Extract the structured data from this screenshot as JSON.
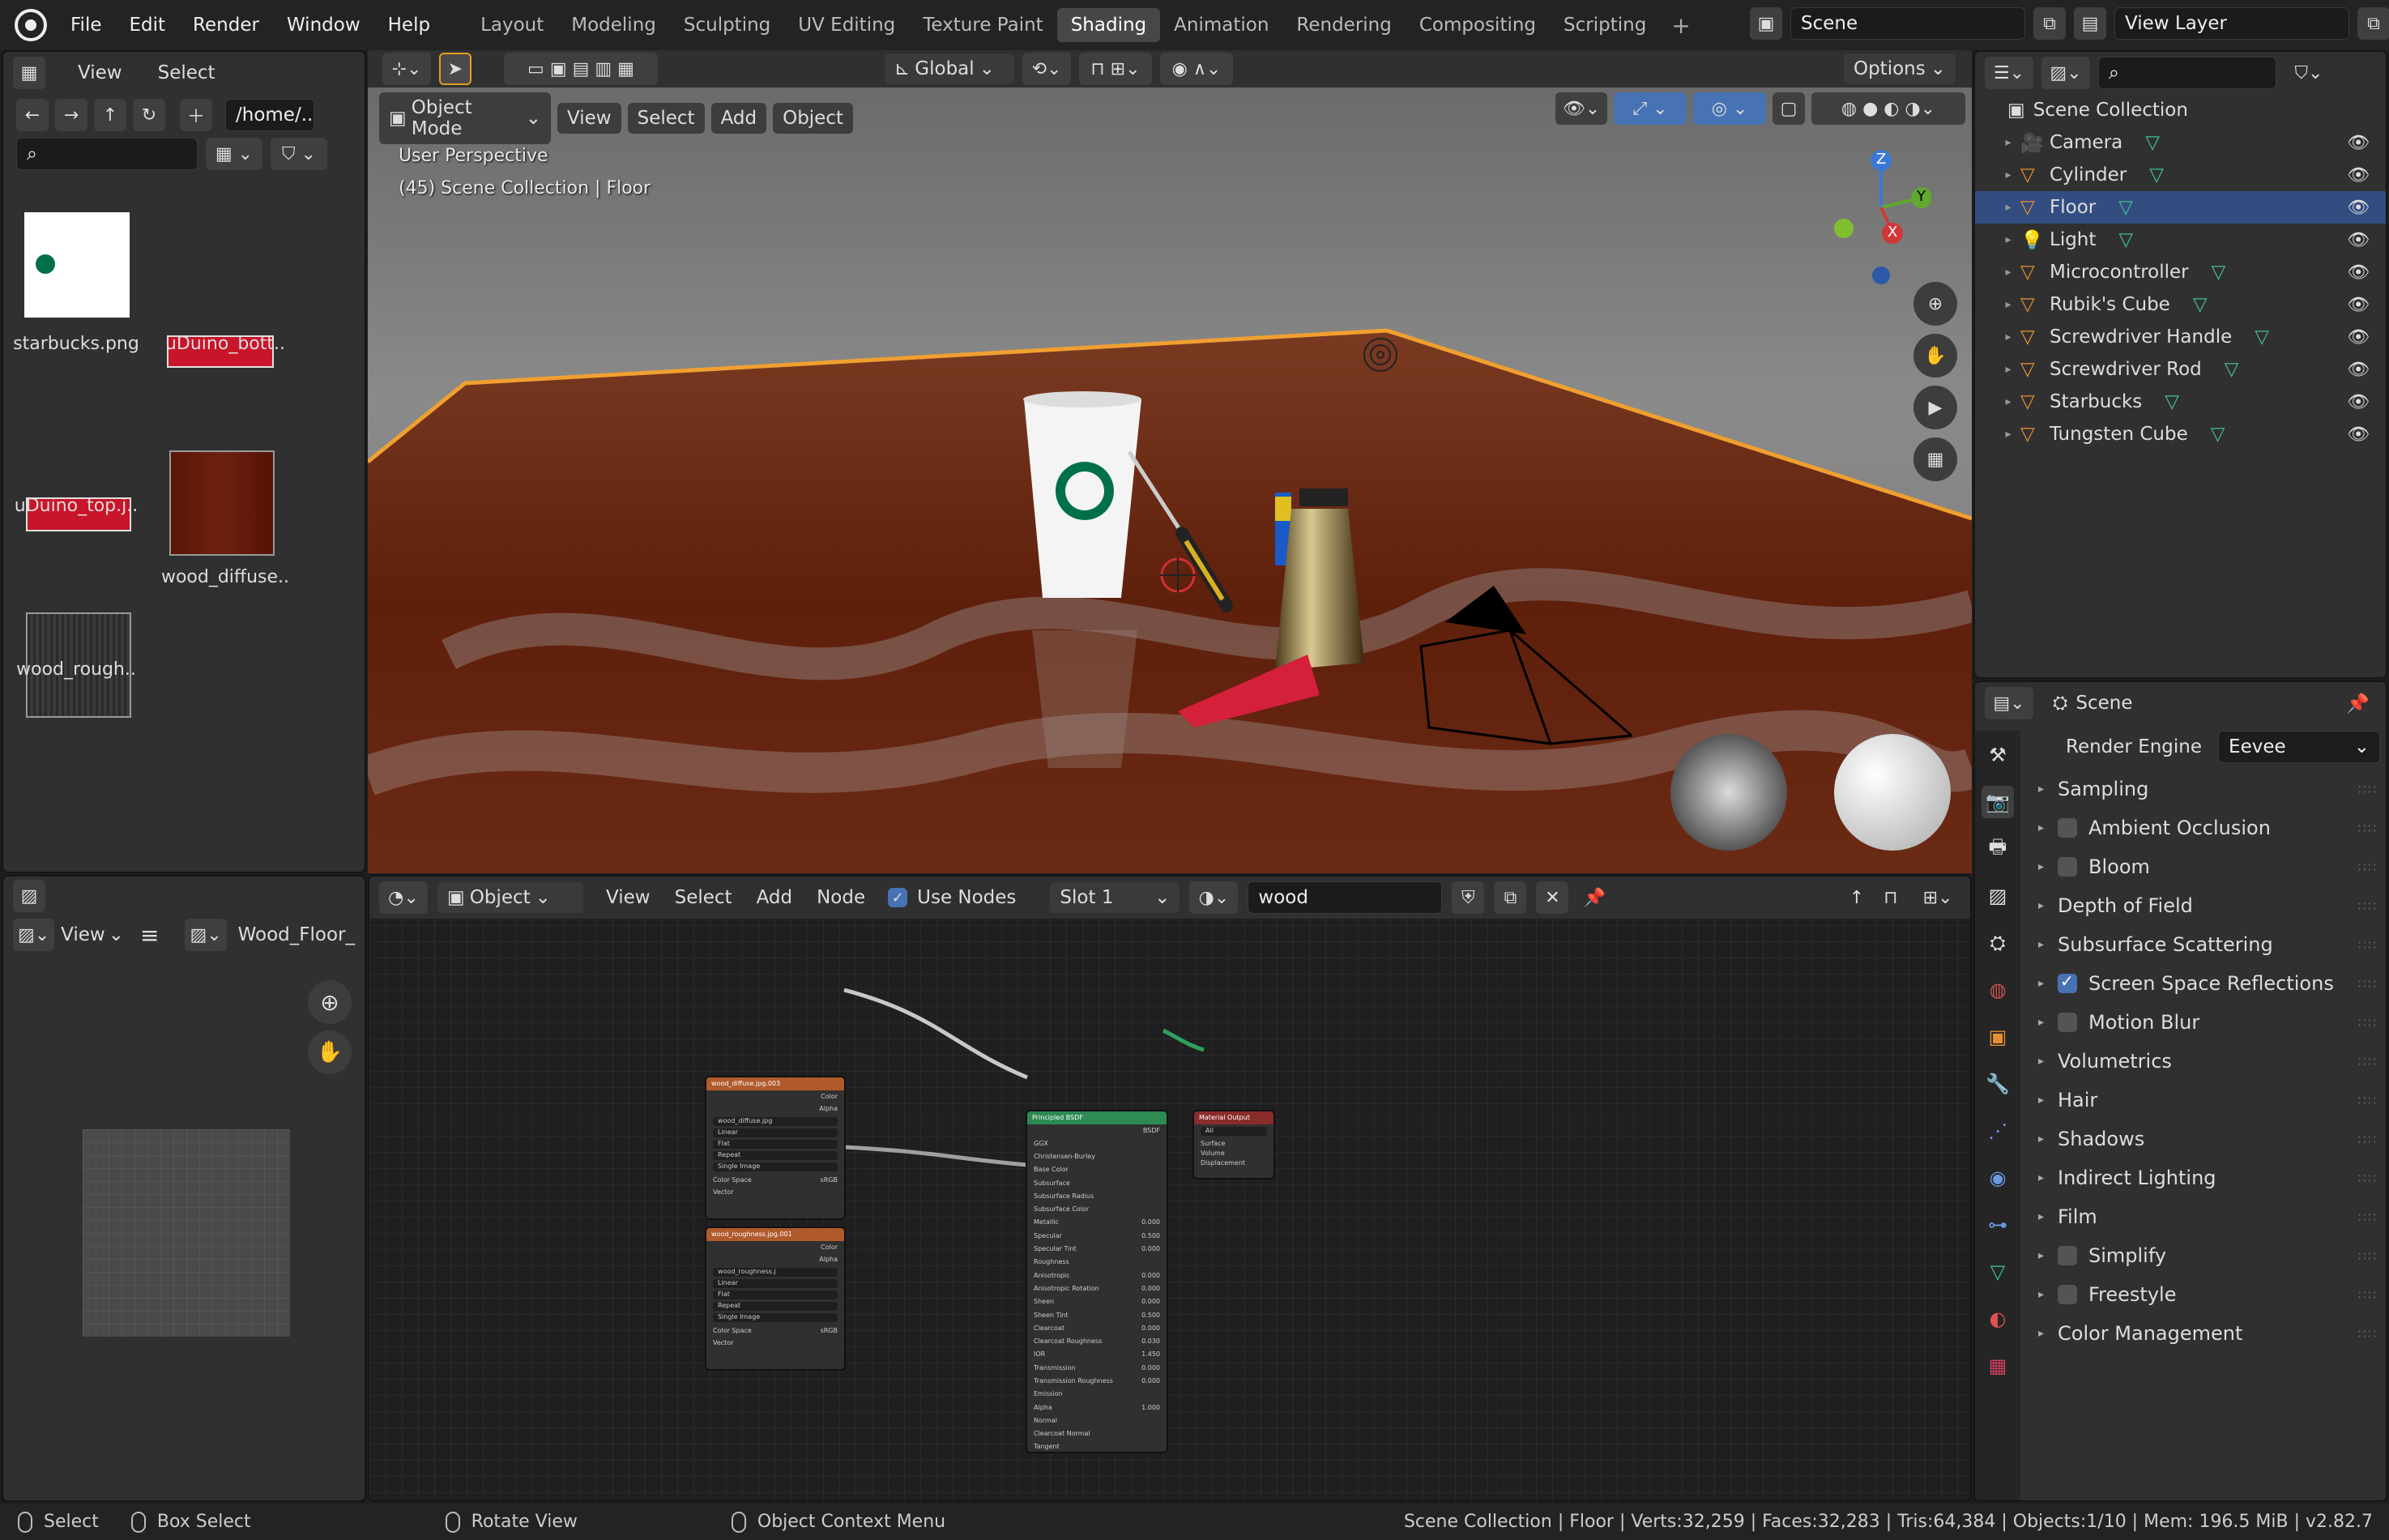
{
  "menubar": {
    "items": [
      "File",
      "Edit",
      "Render",
      "Window",
      "Help"
    ],
    "workspaces": [
      "Layout",
      "Modeling",
      "Sculpting",
      "UV Editing",
      "Texture Paint",
      "Shading",
      "Animation",
      "Rendering",
      "Compositing",
      "Scripting"
    ],
    "active_workspace": "Shading",
    "scene_name": "Scene",
    "view_layer": "View Layer"
  },
  "file_browser": {
    "menu": [
      "View",
      "Select"
    ],
    "path": "/home/..",
    "files": [
      "starbucks.png",
      "uDuino_bott..",
      "uDuino_top.j..",
      "wood_diffuse..",
      "wood_rough.."
    ]
  },
  "viewport": {
    "toolbar": {
      "orientation": "Global",
      "options": "Options"
    },
    "mode": "Object Mode",
    "menu": [
      "View",
      "Select",
      "Add",
      "Object"
    ],
    "perspective": "User Perspective",
    "collection_info": "(45) Scene Collection | Floor",
    "gizmo_axes": [
      "Z",
      "Y",
      "X"
    ]
  },
  "image_editor": {
    "view": "View",
    "image_name": "Wood_Floor_",
    "label": "wood"
  },
  "node_editor": {
    "type": "Object",
    "menu": [
      "View",
      "Select",
      "Add",
      "Node"
    ],
    "use_nodes_label": "Use Nodes",
    "slot": "Slot 1",
    "material": "wood",
    "nodes": {
      "diffuse": {
        "title": "wood_diffuse.jpg.003",
        "rows": [
          "Color",
          "Alpha"
        ],
        "fields": [
          "wood_diffuse.jpg",
          "Linear",
          "Flat",
          "Repeat",
          "Single Image",
          "Color Space",
          "Vector"
        ],
        "color_space": "sRGB"
      },
      "rough": {
        "title": "wood_roughness.jpg.001",
        "rows": [
          "Color",
          "Alpha"
        ],
        "fields": [
          "wood_roughness.j",
          "Linear",
          "Flat",
          "Repeat",
          "Single Image",
          "Color Space",
          "Vector"
        ],
        "color_space": "sRGB"
      },
      "bsdf": {
        "title": "Principled BSDF",
        "out": "BSDF",
        "fields": [
          "GGX",
          "Christensen-Burley",
          "Base Color",
          "Subsurface",
          "Subsurface Radius",
          "Subsurface Color",
          "Metallic",
          "Specular",
          "Specular Tint",
          "Roughness",
          "Anisotropic",
          "Anisotropic Rotation",
          "Sheen",
          "Sheen Tint",
          "Clearcoat",
          "Clearcoat Roughness",
          "IOR",
          "Transmission",
          "Transmission Roughness",
          "Emission",
          "Alpha",
          "Normal",
          "Clearcoat Normal",
          "Tangent"
        ],
        "values": [
          "",
          "",
          "",
          "",
          "",
          "",
          "0.000",
          "0.500",
          "0.000",
          "",
          "0.000",
          "0.000",
          "0.000",
          "0.500",
          "0.000",
          "0.030",
          "1.450",
          "0.000",
          "0.000",
          "",
          "1.000",
          "",
          "",
          ""
        ]
      },
      "output": {
        "title": "Material Output",
        "fields": [
          "All",
          "Surface",
          "Volume",
          "Displacement"
        ]
      }
    }
  },
  "outliner": {
    "root": "Scene Collection",
    "items": [
      {
        "label": "Camera",
        "icon": "camera-icon",
        "selected": false
      },
      {
        "label": "Cylinder",
        "icon": "mesh-icon",
        "selected": false
      },
      {
        "label": "Floor",
        "icon": "mesh-icon",
        "selected": true
      },
      {
        "label": "Light",
        "icon": "light-icon",
        "selected": false
      },
      {
        "label": "Microcontroller",
        "icon": "mesh-icon",
        "selected": false
      },
      {
        "label": "Rubik's Cube",
        "icon": "mesh-icon",
        "selected": false
      },
      {
        "label": "Screwdriver Handle",
        "icon": "mesh-icon",
        "selected": false
      },
      {
        "label": "Screwdriver Rod",
        "icon": "mesh-icon",
        "selected": false
      },
      {
        "label": "Starbucks",
        "icon": "mesh-icon",
        "selected": false
      },
      {
        "label": "Tungsten Cube",
        "icon": "mesh-icon",
        "selected": false
      }
    ]
  },
  "properties": {
    "context": "Scene",
    "render_engine_label": "Render Engine",
    "render_engine": "Eevee",
    "panels": [
      {
        "label": "Sampling",
        "checkbox": null
      },
      {
        "label": "Ambient Occlusion",
        "checkbox": false
      },
      {
        "label": "Bloom",
        "checkbox": false
      },
      {
        "label": "Depth of Field",
        "checkbox": null
      },
      {
        "label": "Subsurface Scattering",
        "checkbox": null
      },
      {
        "label": "Screen Space Reflections",
        "checkbox": true
      },
      {
        "label": "Motion Blur",
        "checkbox": false
      },
      {
        "label": "Volumetrics",
        "checkbox": null
      },
      {
        "label": "Hair",
        "checkbox": null
      },
      {
        "label": "Shadows",
        "checkbox": null
      },
      {
        "label": "Indirect Lighting",
        "checkbox": null
      },
      {
        "label": "Film",
        "checkbox": null
      },
      {
        "label": "Simplify",
        "checkbox": false
      },
      {
        "label": "Freestyle",
        "checkbox": false
      },
      {
        "label": "Color Management",
        "checkbox": null
      }
    ]
  },
  "statusbar": {
    "select": "Select",
    "box_select": "Box Select",
    "rotate": "Rotate View",
    "context_menu": "Object Context Menu",
    "stats": "Scene Collection | Floor | Verts:32,259 | Faces:32,283 | Tris:64,384 | Objects:1/10 | Mem: 196.5 MiB | v2.82.7"
  },
  "colors": {
    "selection": "#334d80",
    "accent": "#4772b3",
    "object_outline": "#f0a030",
    "node_image": "#b05a2c",
    "node_shader": "#2c8a52",
    "node_output": "#8a2c2c"
  }
}
